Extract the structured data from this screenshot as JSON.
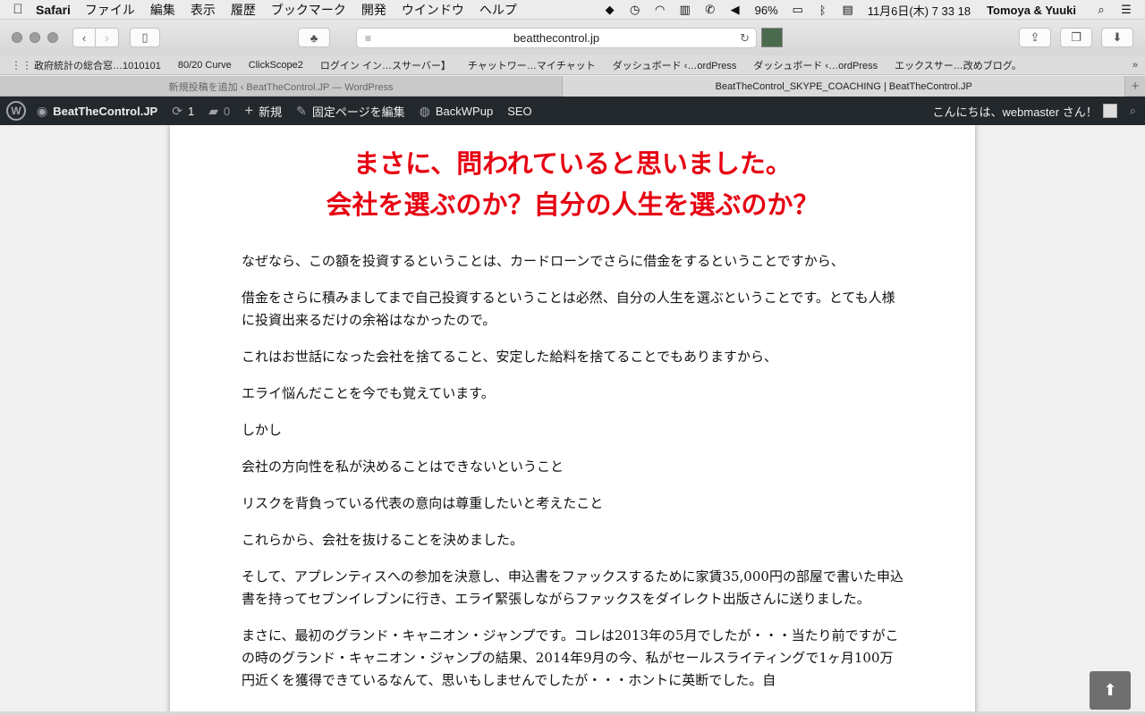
{
  "menubar": {
    "app": "Safari",
    "items": [
      "ファイル",
      "編集",
      "表示",
      "履歴",
      "ブックマーク",
      "開発",
      "ウインドウ",
      "ヘルプ"
    ],
    "battery": "96%",
    "datetime": "11月6日(木)  7 33 18",
    "user": "Tomoya & Yuuki"
  },
  "toolbar": {
    "url": "beatthecontrol.jp"
  },
  "bookmarks": [
    "政府統計の総合窓…1010101",
    "80/20 Curve",
    "ClickScope2",
    "ログイン イン…スサーバー】",
    "チャットワー…マイチャット",
    "ダッシュボード ‹…ordPress",
    "ダッシュボード ‹…ordPress",
    "エックスサー…改めブログ。"
  ],
  "tabs": [
    {
      "label": "新規投稿を追加 ‹ BeatTheControl.JP — WordPress",
      "active": false
    },
    {
      "label": "BeatTheControl_SKYPE_COACHING | BeatTheControl.JP",
      "active": true
    }
  ],
  "adminbar": {
    "site": "BeatTheControl.JP",
    "updates": "1",
    "comments": "0",
    "new": "新規",
    "edit": "固定ページを編集",
    "backwpup": "BackWPup",
    "seo": "SEO",
    "greeting": "こんにちは、webmaster さん！"
  },
  "content": {
    "headline1": "まさに、問われていると思いました。",
    "headline2": "会社を選ぶのか？自分の人生を選ぶのか？",
    "paragraphs": [
      "なぜなら、この額を投資するということは、カードローンでさらに借金をするということですから、",
      "借金をさらに積みましてまで自己投資するということは必然、自分の人生を選ぶということです。とても人様に投資出来るだけの余裕はなかったので。",
      "これはお世話になった会社を捨てること、安定した給料を捨てることでもありますから、",
      "エライ悩んだことを今でも覚えています。",
      "しかし",
      "会社の方向性を私が決めることはできないということ",
      "リスクを背負っている代表の意向は尊重したいと考えたこと",
      "これらから、会社を抜けることを決めました。",
      "そして、アプレンティスへの参加を決意し、申込書をファックスするために家賃35,000円の部屋で書いた申込書を持ってセブンイレブンに行き、エライ緊張しながらファックスをダイレクト出版さんに送りました。",
      "まさに、最初のグランド・キャニオン・ジャンプです。コレは2013年の5月でしたが・・・当たり前ですがこの時のグランド・キャニオン・ジャンプの結果、2014年9月の今、私がセールスライティングで1ヶ月100万円近くを獲得できているなんて、思いもしませんでしたが・・・ホントに英断でした。自"
    ]
  },
  "colors": {
    "headline": "#e60012",
    "adminbar": "#23282d"
  }
}
